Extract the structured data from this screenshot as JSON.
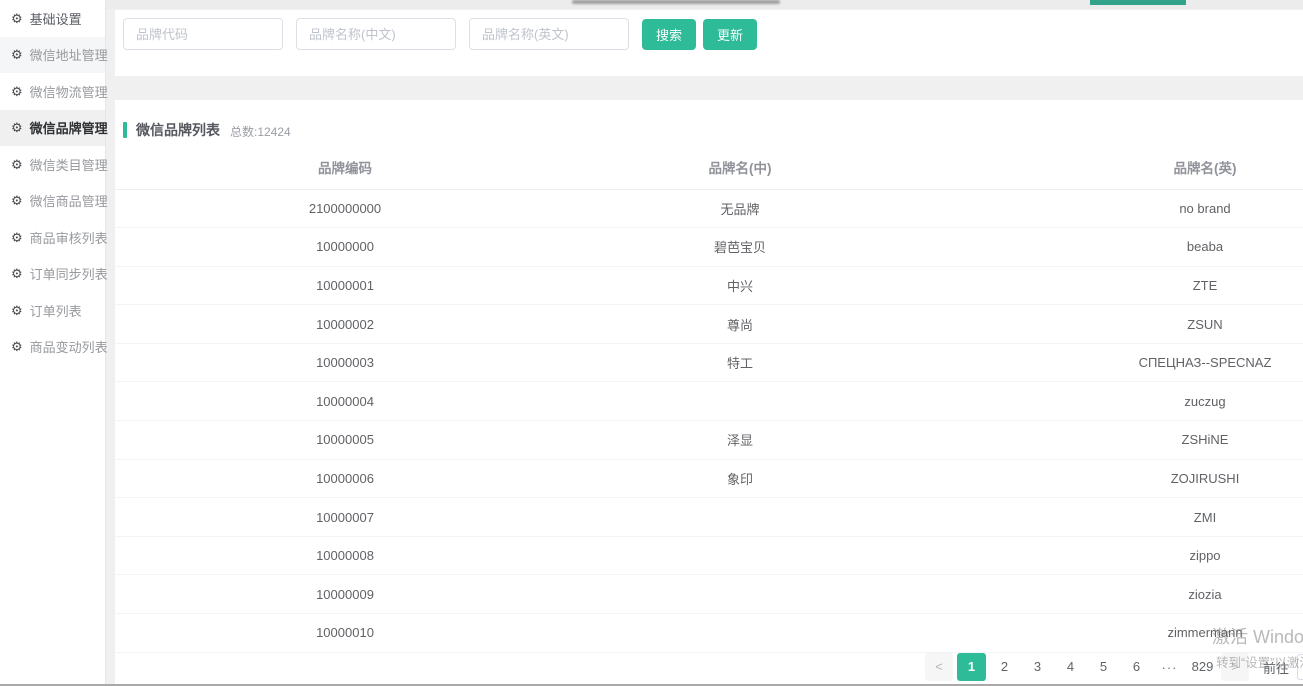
{
  "colors": {
    "accent": "#2ebb97"
  },
  "icons": {
    "gear": "⚙",
    "prev": "<",
    "next": ">",
    "ellipsis": "···"
  },
  "sidebar": {
    "items": [
      {
        "label": "基础设置",
        "state": "dark"
      },
      {
        "label": "微信地址管理",
        "state": "shaded"
      },
      {
        "label": "微信物流管理",
        "state": "normal"
      },
      {
        "label": "微信品牌管理",
        "state": "active"
      },
      {
        "label": "微信类目管理",
        "state": "normal"
      },
      {
        "label": "微信商品管理",
        "state": "normal"
      },
      {
        "label": "商品审核列表",
        "state": "normal"
      },
      {
        "label": "订单同步列表",
        "state": "normal"
      },
      {
        "label": "订单列表",
        "state": "normal"
      },
      {
        "label": "商品变动列表",
        "state": "normal"
      }
    ]
  },
  "search": {
    "fields": [
      {
        "placeholder": "品牌代码"
      },
      {
        "placeholder": "品牌名称(中文)"
      },
      {
        "placeholder": "品牌名称(英文)"
      }
    ],
    "search_label": "搜索",
    "update_label": "更新"
  },
  "panel": {
    "title": "微信品牌列表",
    "total": "总数:12424"
  },
  "table": {
    "columns": [
      "品牌编码",
      "品牌名(中)",
      "品牌名(英)"
    ],
    "rows": [
      {
        "code": "2100000000",
        "cn": "无品牌",
        "en": "no brand"
      },
      {
        "code": "10000000",
        "cn": "碧芭宝贝",
        "en": "beaba"
      },
      {
        "code": "10000001",
        "cn": "中兴",
        "en": "ZTE"
      },
      {
        "code": "10000002",
        "cn": "尊尚",
        "en": "ZSUN"
      },
      {
        "code": "10000003",
        "cn": "特工",
        "en": "СПЕЦНАЗ--SPECNAZ"
      },
      {
        "code": "10000004",
        "cn": "",
        "en": "zuczug"
      },
      {
        "code": "10000005",
        "cn": "泽显",
        "en": "ZSHiNE"
      },
      {
        "code": "10000006",
        "cn": "象印",
        "en": "ZOJIRUSHI"
      },
      {
        "code": "10000007",
        "cn": "",
        "en": "ZMI"
      },
      {
        "code": "10000008",
        "cn": "",
        "en": "zippo"
      },
      {
        "code": "10000009",
        "cn": "",
        "en": "ziozia"
      },
      {
        "code": "10000010",
        "cn": "",
        "en": "zimmermann"
      }
    ]
  },
  "pagination": {
    "pages": [
      {
        "label": "1",
        "state": "active"
      },
      {
        "label": "2",
        "state": "normal"
      },
      {
        "label": "3",
        "state": "normal"
      },
      {
        "label": "4",
        "state": "normal"
      },
      {
        "label": "5",
        "state": "normal"
      },
      {
        "label": "6",
        "state": "normal"
      }
    ],
    "last_page": "829",
    "jump_label": "前往"
  },
  "watermark": {
    "line1": "激活 Windo",
    "line2": "转到“设置”以激活"
  }
}
